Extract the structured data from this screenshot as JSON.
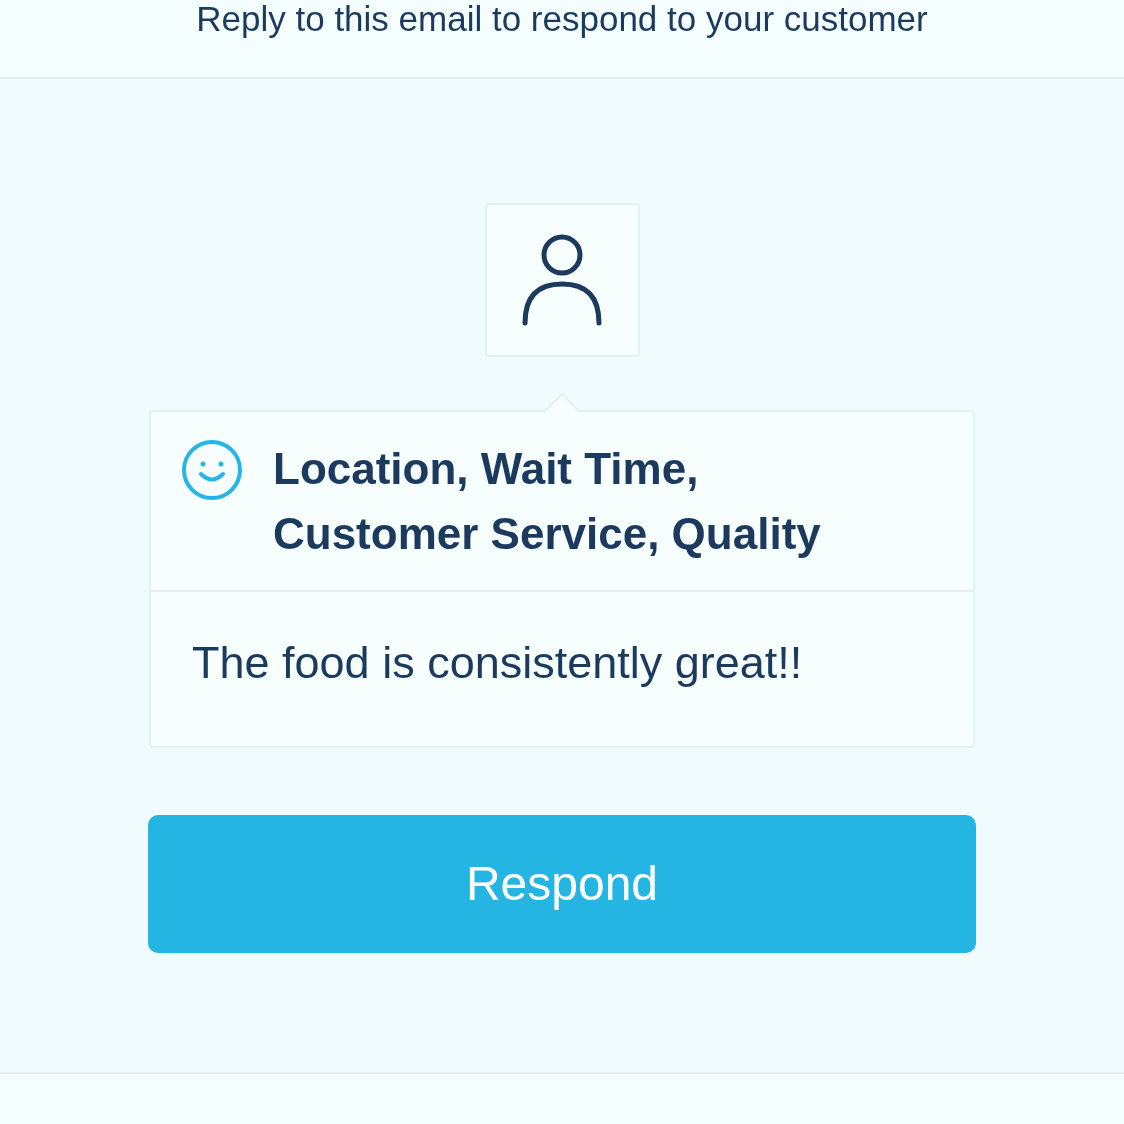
{
  "header": {
    "text": "Reply to this email to respond to your customer"
  },
  "feedback": {
    "kind": "positive",
    "topics": "Location, Wait Time, Customer Service, Quality",
    "comment": "The food is consistently great!!"
  },
  "button": {
    "label": "Respond"
  }
}
